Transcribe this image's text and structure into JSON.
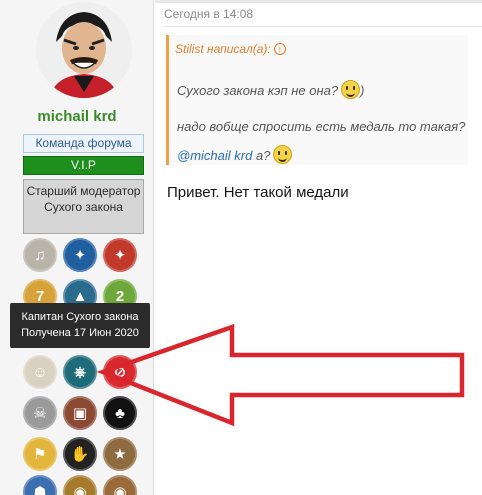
{
  "user": {
    "username": "michail krd",
    "badges": [
      "Команда форума",
      "V.I.P",
      "Старший модератор Сухого закона"
    ]
  },
  "medals": [
    {
      "name": "gramophone-medal-icon",
      "color": "#b9b4aa",
      "symbol": "♫"
    },
    {
      "name": "blue-ornament-medal-icon",
      "color": "#1f5f9f",
      "symbol": "✦"
    },
    {
      "name": "red-ornament-medal-icon",
      "color": "#c0392b",
      "symbol": "✦"
    },
    {
      "name": "number-seven-medal-icon",
      "color": "#d8a23a",
      "symbol": "7"
    },
    {
      "name": "mountain-medal-icon",
      "color": "#2b6c8e",
      "symbol": "▲"
    },
    {
      "name": "snake-medal-icon",
      "color": "#6ea83b",
      "symbol": "2"
    },
    {
      "name": "captain-medal-icon",
      "color": "#d9d2c2",
      "symbol": "☺"
    },
    {
      "name": "ship-wheel-medal-icon",
      "color": "#1e6b7a",
      "symbol": "⎈"
    },
    {
      "name": "no-alcohol-medal-icon",
      "color": "#d8292f",
      "symbol": "⊘"
    },
    {
      "name": "skull-medal-icon",
      "color": "#9a9a9a",
      "symbol": "☠"
    },
    {
      "name": "suitcase-medal-icon",
      "color": "#8b4a34",
      "symbol": "▣"
    },
    {
      "name": "clubs-medal-icon",
      "color": "#111111",
      "symbol": "♣"
    },
    {
      "name": "flag-medal-icon",
      "color": "#e3b53d",
      "symbol": "⚑"
    },
    {
      "name": "hand-medal-icon",
      "color": "#222222",
      "symbol": "✋"
    },
    {
      "name": "star-medal-icon",
      "color": "#8e6a3f",
      "symbol": "★"
    },
    {
      "name": "group-medal-icon",
      "color": "#3c6fb0",
      "symbol": "☗"
    },
    {
      "name": "gold-medal-icon",
      "color": "#a67a2a",
      "symbol": "◉"
    },
    {
      "name": "bronze-medal-icon",
      "color": "#9a6a3a",
      "symbol": "◉"
    }
  ],
  "tooltip": {
    "line1": "Капитан Сухого закона",
    "line2": "Получена 17 Июн 2020"
  },
  "post": {
    "date": "Сегодня в 14:08",
    "quote": {
      "author": "Stilist написал(а):",
      "up_icon": "↑",
      "line1": "Сухого закона кэп не она?",
      "line1_suffix": ")",
      "line2": "надо вобще спросить есть медаль то такая?",
      "line3_mention": "@michail krd",
      "line3_rest": " а?"
    },
    "body": "Привет. Нет такой медали"
  },
  "annotation": {
    "arrow_color": "#d9262c",
    "arrow_icon": "arrow-left-icon"
  }
}
